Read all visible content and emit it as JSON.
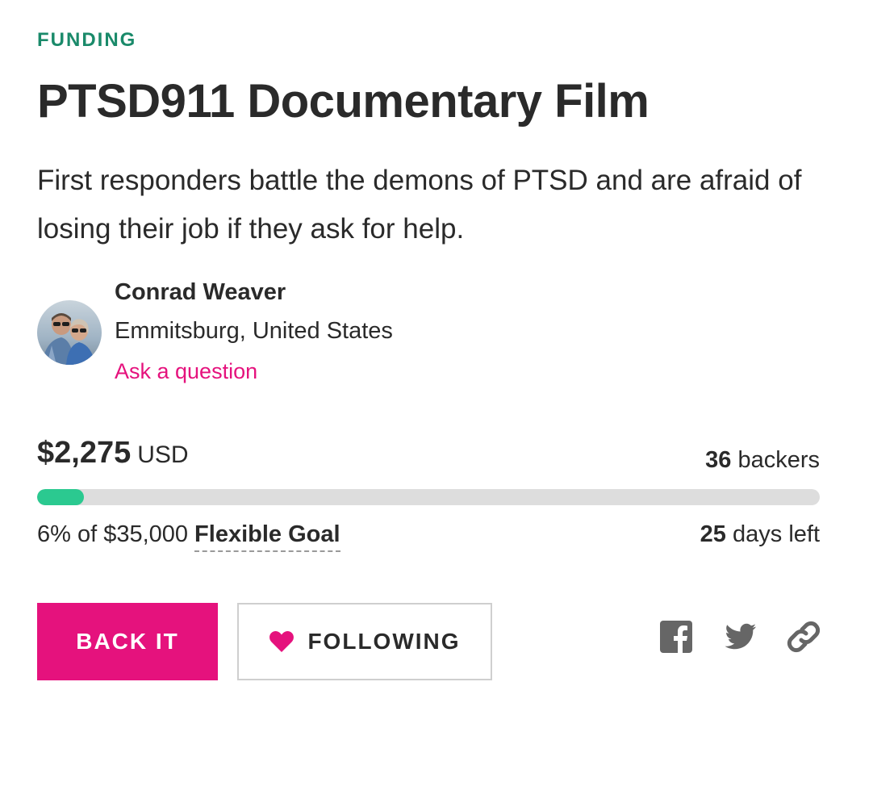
{
  "campaign": {
    "stage": "FUNDING",
    "title": "PTSD911 Documentary Film",
    "blurb": "First responders battle the demons of PTSD and are afraid of losing their job if they ask for help."
  },
  "owner": {
    "name": "Conrad Weaver",
    "location": "Emmitsburg, United States",
    "ask_label": "Ask a question"
  },
  "funding": {
    "raised": "$2,275",
    "currency": "USD",
    "backers_count": "36",
    "backers_label": "backers",
    "progress_percent": 6,
    "goal_text": "6% of $35,000",
    "goal_type": "Flexible Goal",
    "days_count": "25",
    "days_label": "days left"
  },
  "actions": {
    "back_label": "BACK IT",
    "follow_label": "FOLLOWING"
  },
  "share": {
    "icons": [
      "facebook-icon",
      "twitter-icon",
      "link-icon"
    ],
    "icon_color": "#666666"
  },
  "colors": {
    "accent": "#e5127d",
    "stage": "#1a8a6a",
    "progress": "#2bc990",
    "track": "#dddddd"
  }
}
